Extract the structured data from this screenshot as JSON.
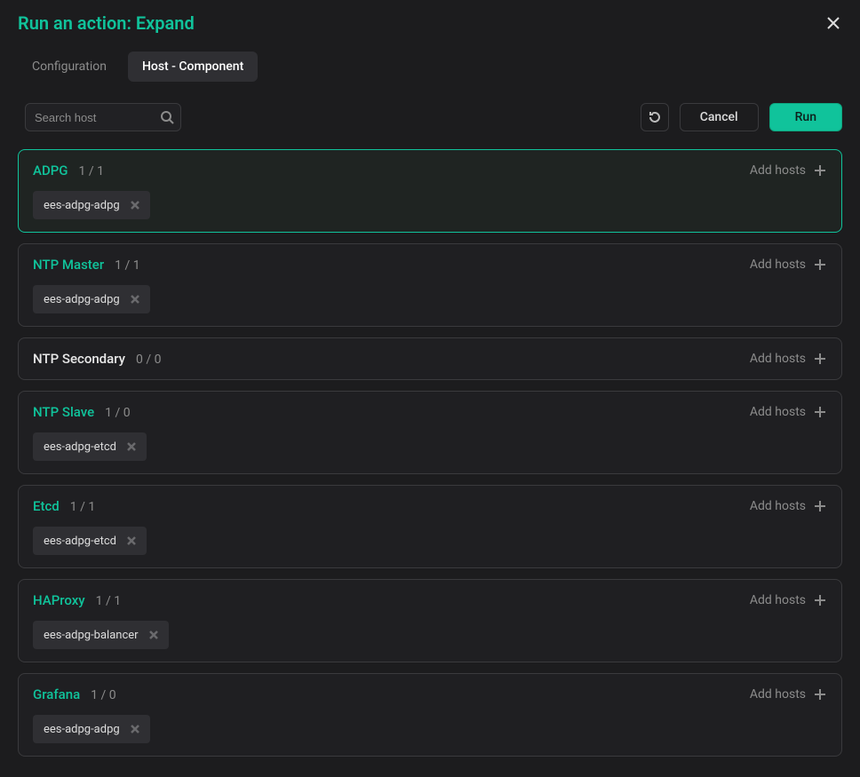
{
  "dialog": {
    "title": "Run an action: Expand"
  },
  "tabs": {
    "configuration": "Configuration",
    "host_component": "Host - Component"
  },
  "toolbar": {
    "search_placeholder": "Search host",
    "cancel": "Cancel",
    "run": "Run"
  },
  "labels": {
    "add_hosts": "Add hosts"
  },
  "groups": [
    {
      "name": "ADPG",
      "count": "1 / 1",
      "highlight": true,
      "name_color": "accent",
      "tags": [
        "ees-adpg-adpg"
      ]
    },
    {
      "name": "NTP Master",
      "count": "1 / 1",
      "highlight": false,
      "name_color": "accent",
      "tags": [
        "ees-adpg-adpg"
      ]
    },
    {
      "name": "NTP Secondary",
      "count": "0 / 0",
      "highlight": false,
      "name_color": "muted",
      "tags": []
    },
    {
      "name": "NTP Slave",
      "count": "1 / 0",
      "highlight": false,
      "name_color": "accent",
      "tags": [
        "ees-adpg-etcd"
      ]
    },
    {
      "name": "Etcd",
      "count": "1 / 1",
      "highlight": false,
      "name_color": "accent",
      "tags": [
        "ees-adpg-etcd"
      ]
    },
    {
      "name": "HAProxy",
      "count": "1 / 1",
      "highlight": false,
      "name_color": "accent",
      "tags": [
        "ees-adpg-balancer"
      ]
    },
    {
      "name": "Grafana",
      "count": "1 / 0",
      "highlight": false,
      "name_color": "accent",
      "tags": [
        "ees-adpg-adpg"
      ]
    }
  ]
}
